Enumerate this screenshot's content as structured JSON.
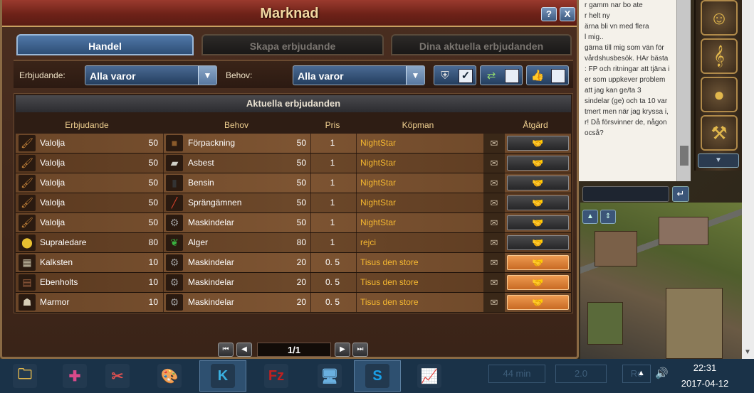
{
  "market": {
    "title": "Marknad",
    "help_label": "?",
    "close_label": "X",
    "tabs": [
      {
        "label": "Handel",
        "active": true
      },
      {
        "label": "Skapa erbjudande",
        "active": false
      },
      {
        "label": "Dina aktuella erbjudanden",
        "active": false
      }
    ],
    "filters": {
      "offer_label": "Erbjudande:",
      "offer_value": "Alla varor",
      "need_label": "Behov:",
      "need_value": "Alla varor",
      "check_mark": "✓"
    },
    "offers_title": "Aktuella erbjudanden",
    "columns": [
      "Erbjudande",
      "Behov",
      "Pris",
      "Köpman",
      "Åtgärd"
    ],
    "rows": [
      {
        "offer": "Valolja",
        "offer_qty": "50",
        "need": "Förpackning",
        "need_qty": "50",
        "price": "1",
        "seller": "NightStar",
        "action": "dark"
      },
      {
        "offer": "Valolja",
        "offer_qty": "50",
        "need": "Asbest",
        "need_qty": "50",
        "price": "1",
        "seller": "NightStar",
        "action": "dark"
      },
      {
        "offer": "Valolja",
        "offer_qty": "50",
        "need": "Bensin",
        "need_qty": "50",
        "price": "1",
        "seller": "NightStar",
        "action": "dark"
      },
      {
        "offer": "Valolja",
        "offer_qty": "50",
        "need": "Sprängämnen",
        "need_qty": "50",
        "price": "1",
        "seller": "NightStar",
        "action": "dark"
      },
      {
        "offer": "Valolja",
        "offer_qty": "50",
        "need": "Maskindelar",
        "need_qty": "50",
        "price": "1",
        "seller": "NightStar",
        "action": "dark"
      },
      {
        "offer": "Supraledare",
        "offer_qty": "80",
        "need": "Alger",
        "need_qty": "80",
        "price": "1",
        "seller": "rejci",
        "action": "dark"
      },
      {
        "offer": "Kalksten",
        "offer_qty": "10",
        "need": "Maskindelar",
        "need_qty": "20",
        "price": "0. 5",
        "seller": "Tisus den store",
        "action": "orange"
      },
      {
        "offer": "Ebenholts",
        "offer_qty": "10",
        "need": "Maskindelar",
        "need_qty": "20",
        "price": "0. 5",
        "seller": "Tisus den store",
        "action": "orange"
      },
      {
        "offer": "Marmor",
        "offer_qty": "10",
        "need": "Maskindelar",
        "need_qty": "20",
        "price": "0. 5",
        "seller": "Tisus den store",
        "action": "orange"
      }
    ],
    "pager": {
      "page": "1/1"
    }
  },
  "chat": {
    "lines": [
      "r gamm nar bo ate",
      "r helt ny",
      "ärna bli vn med flera",
      "l mig..",
      "gärna till mig som vän för",
      "vårdshusbesök. HAr bästa",
      "",
      ": FP och ritningar att tjäna i",
      "",
      "er som uppkever problem",
      " att jag kan ge/ta 3",
      "sindelar (ge) och ta 10 var",
      "",
      "tmert men när jag kryssa i,",
      "r! Då försvinner de, någon",
      "ocså?"
    ]
  },
  "taskbar": {
    "apps": [
      {
        "name": "file-explorer-icon",
        "glyph": "🗀",
        "color": "#f4c44c"
      },
      {
        "name": "puzzle-app-icon",
        "glyph": "✚",
        "color": "#d84a8a"
      },
      {
        "name": "snipping-tool-icon",
        "glyph": "✂",
        "color": "#e05050"
      },
      {
        "name": "paint-icon",
        "glyph": "🎨",
        "color": "#f0d070"
      },
      {
        "name": "kodi-icon",
        "glyph": "K",
        "color": "#3ab0e0"
      },
      {
        "name": "filezilla-icon",
        "glyph": "Fz",
        "color": "#c02020"
      },
      {
        "name": "remote-desktop-icon",
        "glyph": "🖥",
        "color": "#6ab0e0"
      },
      {
        "name": "skype-icon",
        "glyph": "S",
        "color": "#1aa0e8"
      },
      {
        "name": "task-manager-icon",
        "glyph": "📈",
        "color": "#9ac0e0"
      }
    ],
    "faded": [
      "44 min",
      "2.0",
      "Ro"
    ],
    "time": "22:31",
    "date": "2017-04-12"
  }
}
